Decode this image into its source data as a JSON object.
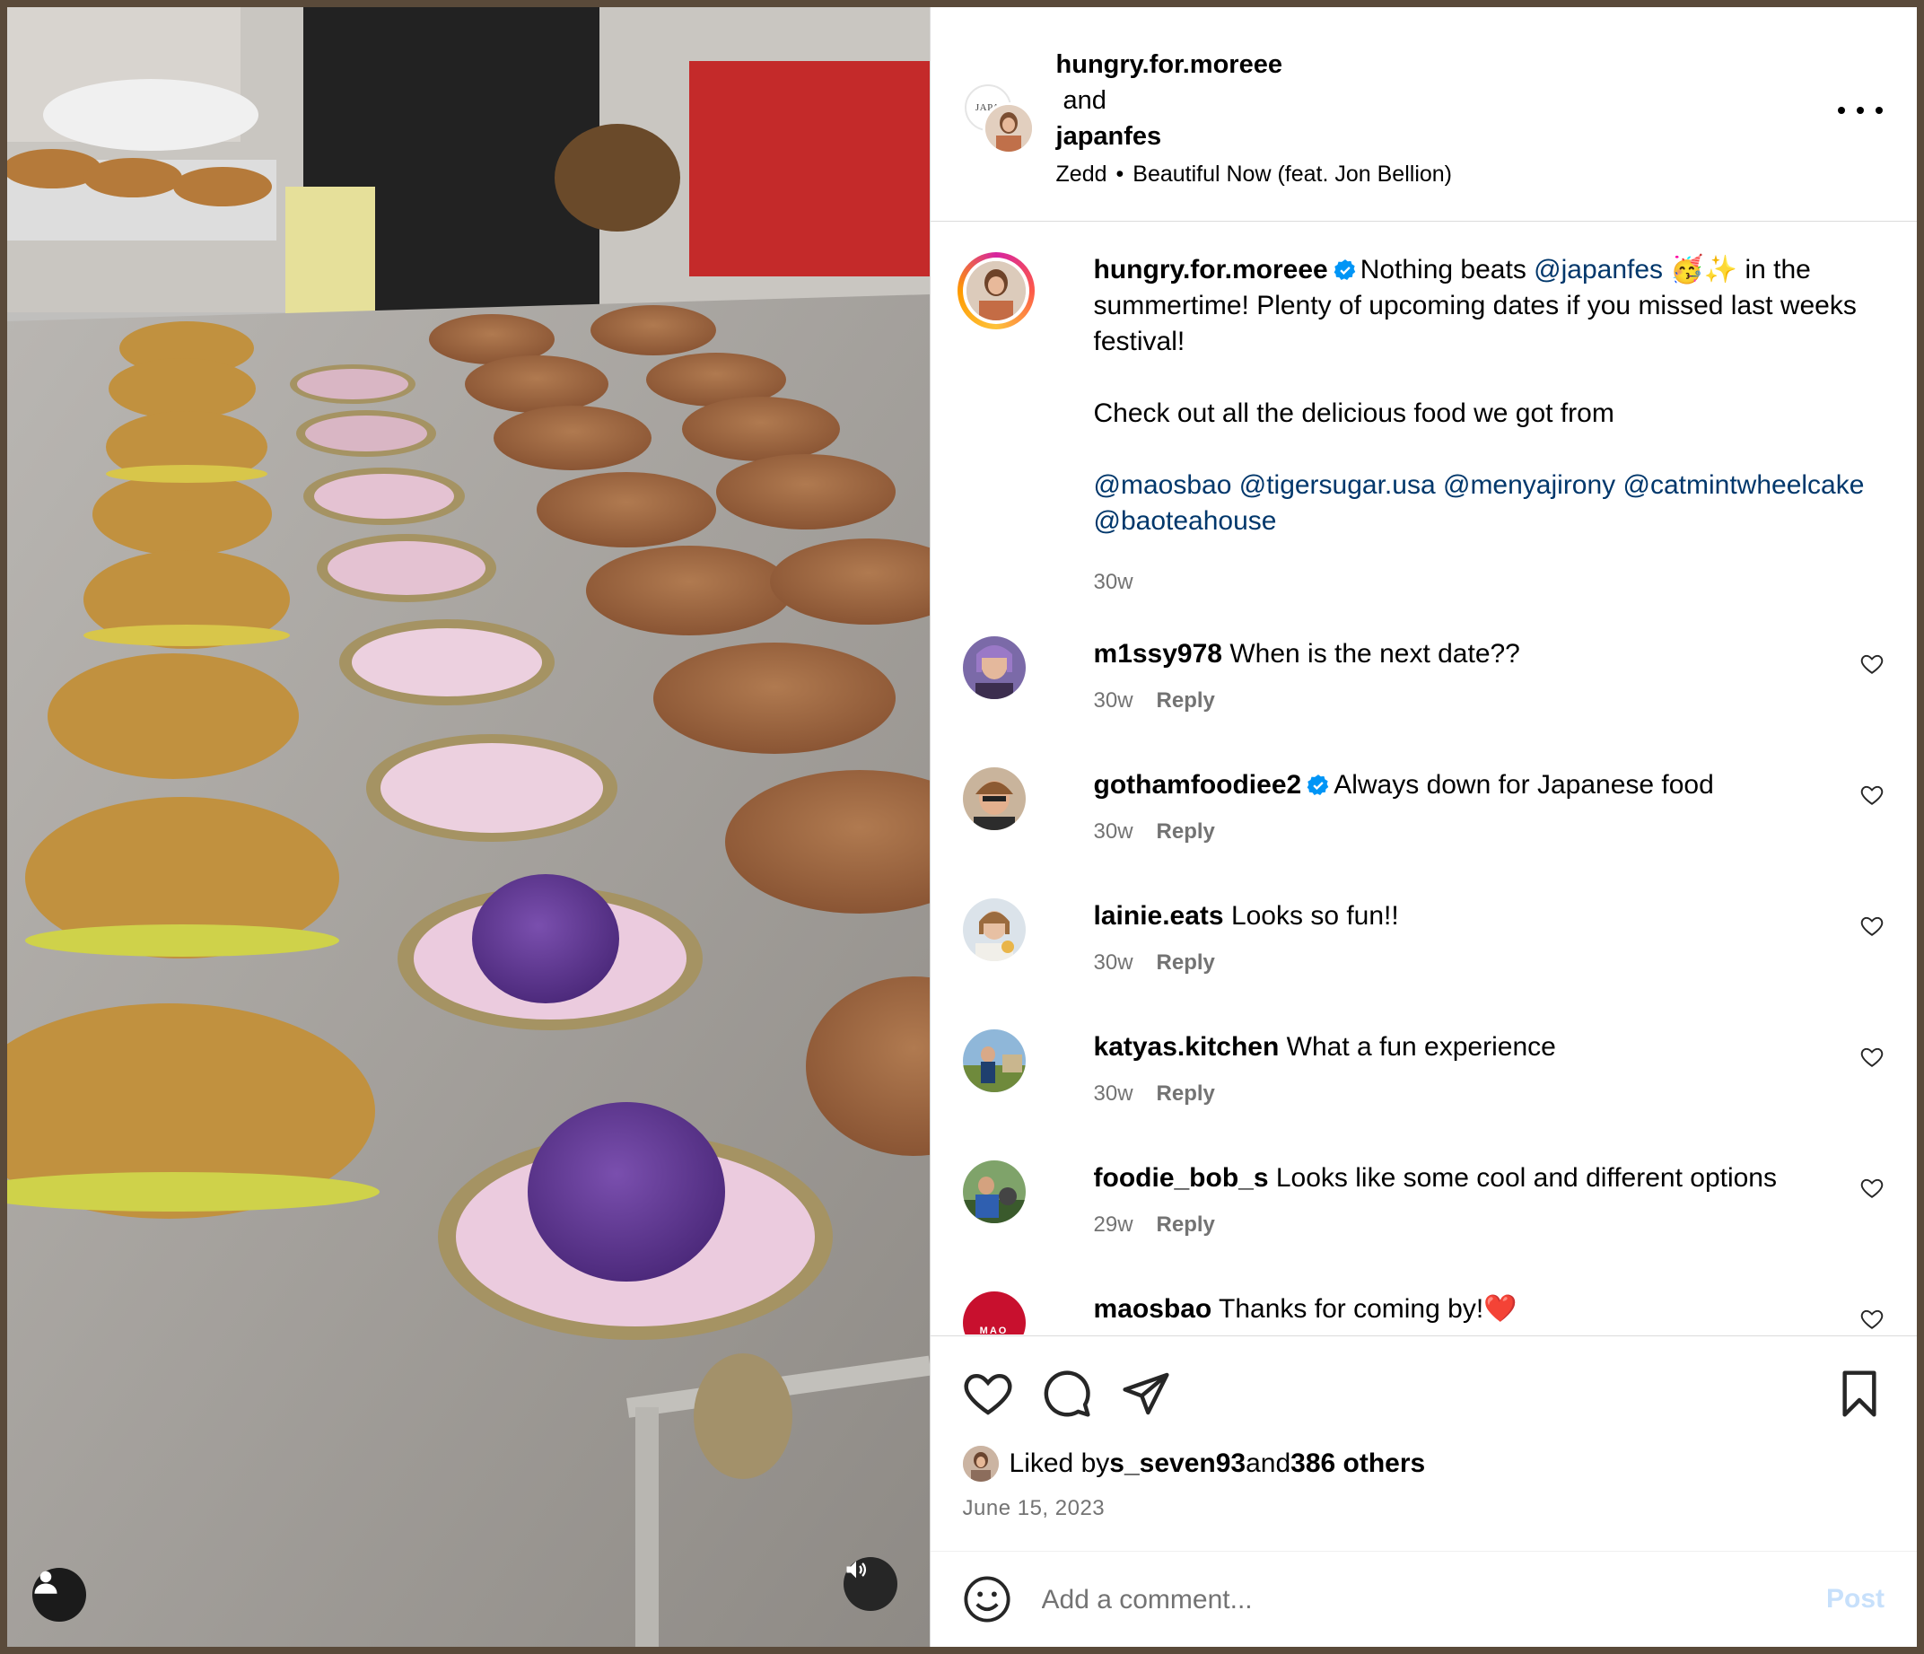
{
  "header": {
    "user1": "hungry.for.moreee",
    "joiner": "and",
    "user2": "japanfes",
    "artist": "Zedd",
    "separator": "•",
    "song": "Beautiful Now (feat. Jon Bellion)",
    "more_icon": "more-horizontal-icon",
    "back_avatar_text": "JAPA"
  },
  "caption": {
    "username": "hungry.for.moreee",
    "line1_pre": "Nothing beats ",
    "line1_mention": "@japanfes",
    "line1_emoji": "🥳✨",
    "line1_post": " in the summertime! Plenty of upcoming dates if you missed last weeks festival!",
    "para2": "Check out all the delicious food we got from",
    "mentions": [
      "@maosbao",
      "@tigersugar.usa",
      "@menyajirony",
      "@catmintwheelcake",
      "@baoteahouse"
    ],
    "time": "30w"
  },
  "comments": [
    {
      "username": "m1ssy978",
      "text": "When is the next date??",
      "time": "30w",
      "reply": "Reply",
      "verified": false
    },
    {
      "username": "gothamfoodiee2",
      "text": "Always down for Japanese food",
      "time": "30w",
      "reply": "Reply",
      "verified": true
    },
    {
      "username": "lainie.eats",
      "text": "Looks so fun!!",
      "time": "30w",
      "reply": "Reply",
      "verified": false
    },
    {
      "username": "katyas.kitchen",
      "text": "What a fun experience",
      "time": "30w",
      "reply": "Reply",
      "verified": false
    },
    {
      "username": "foodie_bob_s",
      "text": "Looks like some cool and different options",
      "time": "29w",
      "reply": "Reply",
      "verified": false
    },
    {
      "username": "maosbao",
      "text": "Thanks for coming by!❤️",
      "time": "",
      "reply": "",
      "verified": false,
      "avatar_text": "MAO"
    }
  ],
  "likes": {
    "prefix": "Liked by ",
    "user": "s_seven93",
    "middle": " and ",
    "others": "386 others"
  },
  "date": "June 15, 2023",
  "add_comment": {
    "placeholder": "Add a comment...",
    "post_label": "Post"
  },
  "colors": {
    "mention": "#00376b",
    "secondary_text": "#737373",
    "verified": "#0095f6",
    "post_disabled": "#c7e0fb",
    "heart_red": "#e0245e"
  }
}
